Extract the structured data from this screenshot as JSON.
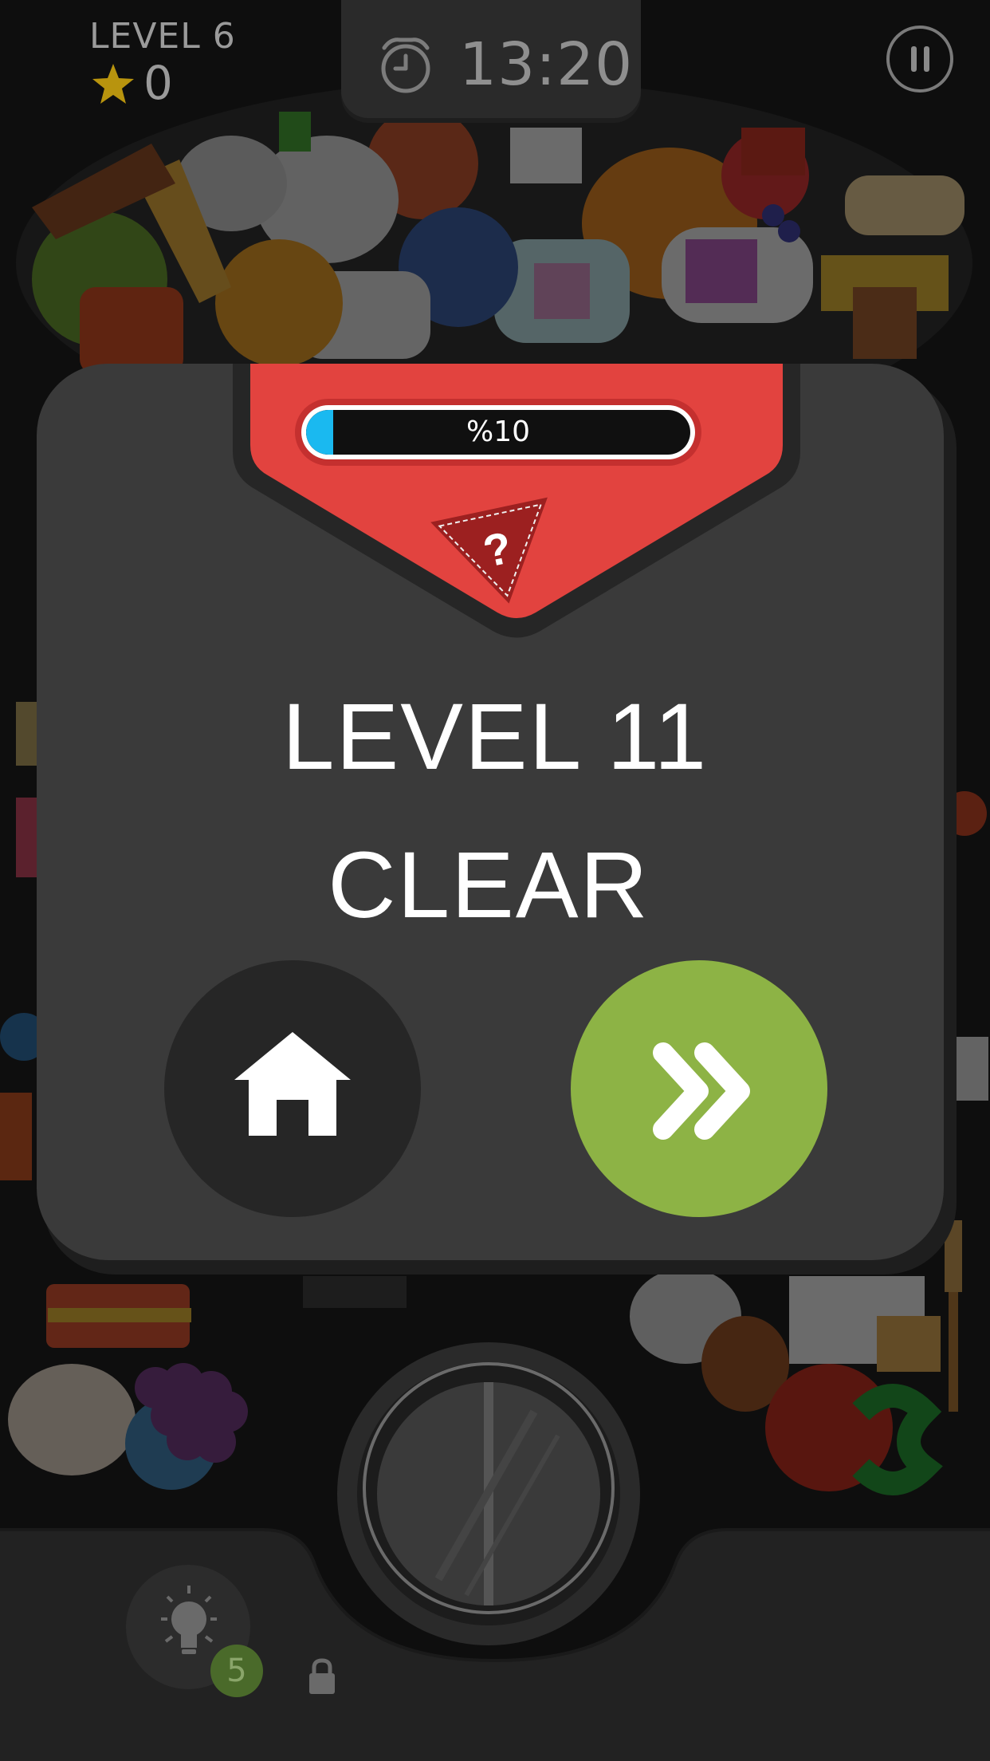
{
  "hud": {
    "level_label": "LEVEL 6",
    "stars": "0",
    "timer": "13:20"
  },
  "dialog": {
    "progress_text": "%10",
    "progress_fraction": 0.1,
    "badge_symbol": "?",
    "title_line1": "LEVEL 11",
    "title_line2": "CLEAR"
  },
  "hint": {
    "count": "5"
  },
  "colors": {
    "ribbon_red": "#e2433f",
    "progress_blue": "#1ab9f0",
    "next_green": "#8db345",
    "dialog_gray": "#3a3a3a"
  },
  "icons": [
    "star-icon",
    "clock-icon",
    "pause-icon",
    "question-badge-icon",
    "home-icon",
    "fast-forward-icon",
    "lightbulb-icon",
    "lock-icon"
  ]
}
